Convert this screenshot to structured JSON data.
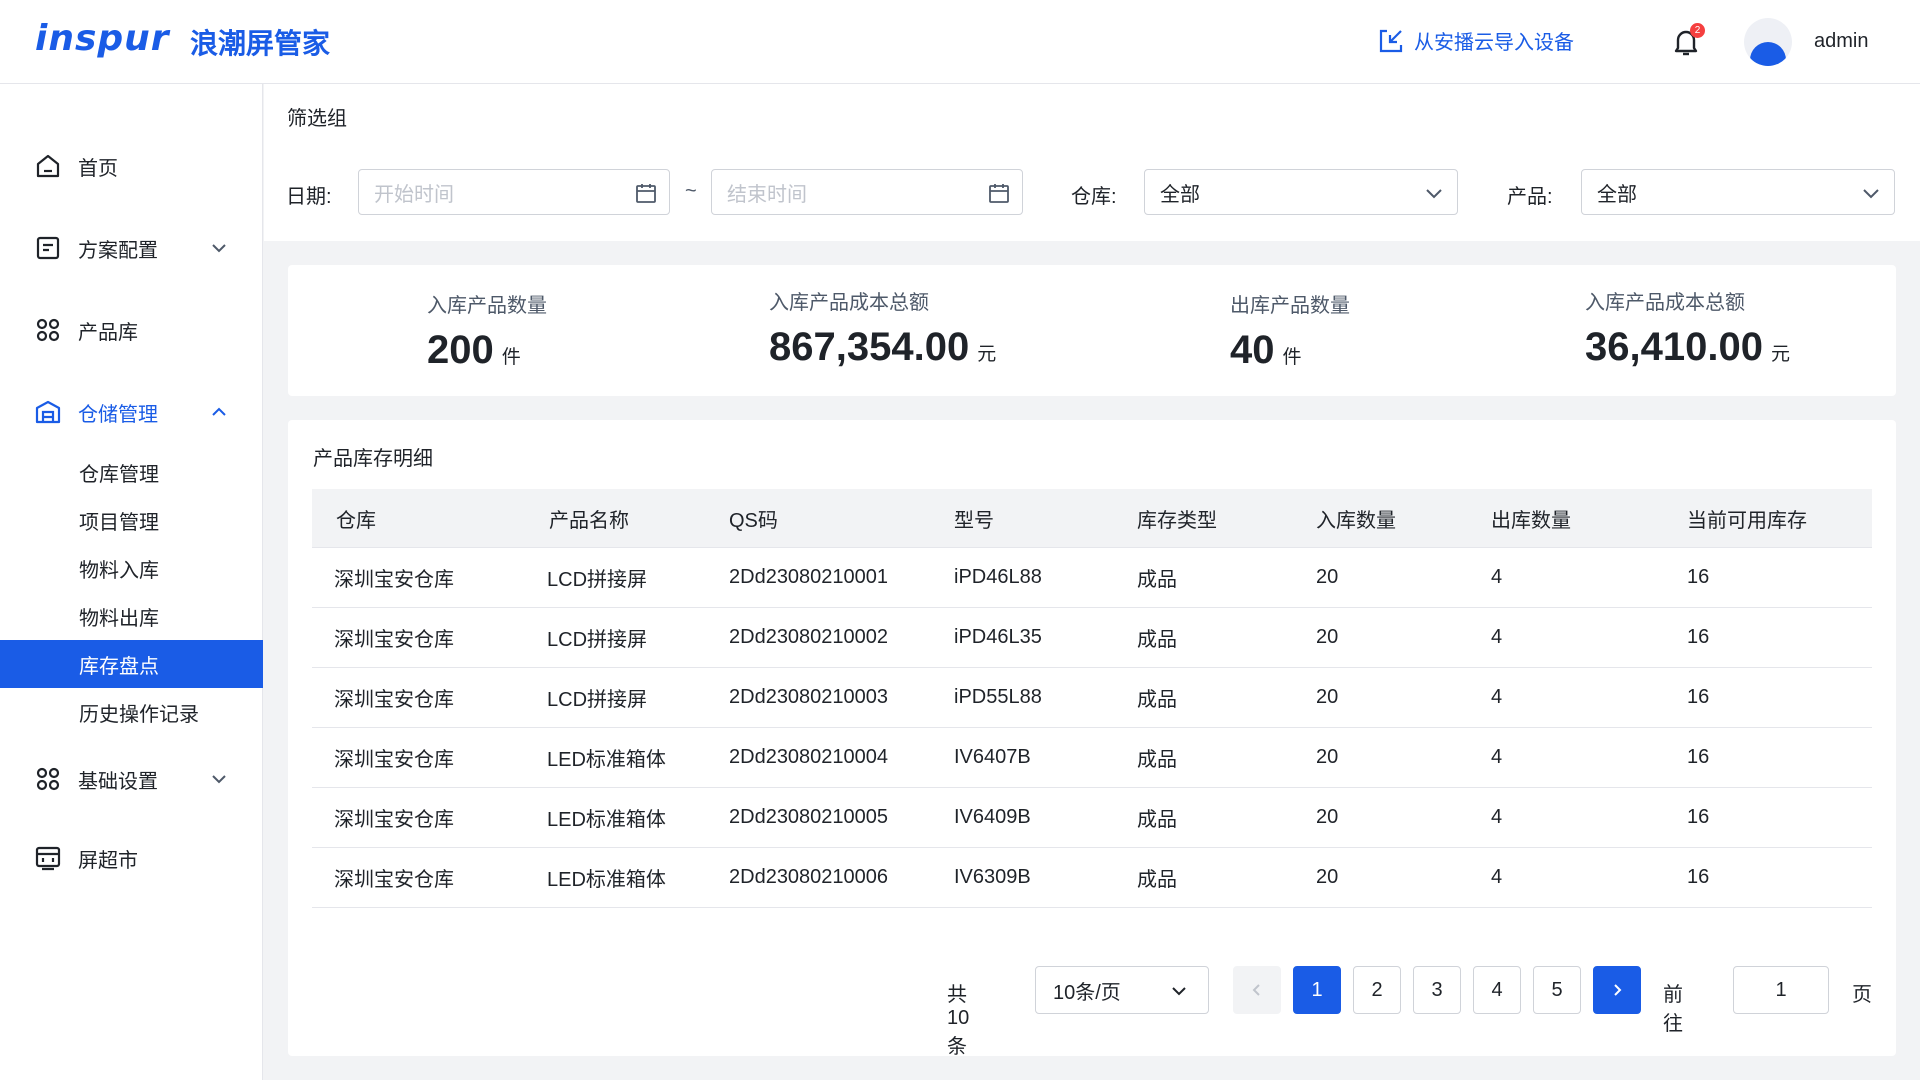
{
  "header": {
    "logo_text": "inspur",
    "brand": "浪潮屏管家",
    "import_label": "从安播云导入设备",
    "notification_count": "2",
    "username": "admin"
  },
  "sidebar": {
    "items": [
      {
        "label": "首页",
        "icon": "home-icon"
      },
      {
        "label": "方案配置",
        "icon": "document-icon"
      },
      {
        "label": "产品库",
        "icon": "grid-icon"
      },
      {
        "label": "仓储管理",
        "icon": "warehouse-icon"
      },
      {
        "label": "基础设置",
        "icon": "grid-icon"
      },
      {
        "label": "屏超市",
        "icon": "store-icon"
      }
    ],
    "sub_items": [
      "仓库管理",
      "项目管理",
      "物料入库",
      "物料出库",
      "库存盘点",
      "历史操作记录"
    ],
    "active_sub": "库存盘点"
  },
  "filter": {
    "title": "筛选组",
    "date_label": "日期:",
    "start_placeholder": "开始时间",
    "separator": "~",
    "end_placeholder": "结束时间",
    "warehouse_label": "仓库:",
    "warehouse_value": "全部",
    "product_label": "产品:",
    "product_value": "全部"
  },
  "stats": [
    {
      "label": "入库产品数量",
      "value": "200",
      "unit": "件"
    },
    {
      "label": "入库产品成本总额",
      "value": "867,354.00",
      "unit": "元"
    },
    {
      "label": "出库产品数量",
      "value": "40",
      "unit": "件"
    },
    {
      "label": "入库产品成本总额",
      "value": "36,410.00",
      "unit": "元"
    }
  ],
  "table": {
    "title": "产品库存明细",
    "columns": [
      "仓库",
      "产品名称",
      "QS码",
      "型号",
      "库存类型",
      "入库数量",
      "出库数量",
      "当前可用库存"
    ],
    "rows": [
      [
        "深圳宝安仓库",
        "LCD拼接屏",
        "2Dd23080210001",
        "iPD46L88",
        "成品",
        "20",
        "4",
        "16"
      ],
      [
        "深圳宝安仓库",
        "LCD拼接屏",
        "2Dd23080210002",
        "iPD46L35",
        "成品",
        "20",
        "4",
        "16"
      ],
      [
        "深圳宝安仓库",
        "LCD拼接屏",
        "2Dd23080210003",
        "iPD55L88",
        "成品",
        "20",
        "4",
        "16"
      ],
      [
        "深圳宝安仓库",
        "LED标准箱体",
        "2Dd23080210004",
        "IV6407B",
        "成品",
        "20",
        "4",
        "16"
      ],
      [
        "深圳宝安仓库",
        "LED标准箱体",
        "2Dd23080210005",
        "IV6409B",
        "成品",
        "20",
        "4",
        "16"
      ],
      [
        "深圳宝安仓库",
        "LED标准箱体",
        "2Dd23080210006",
        "IV6309B",
        "成品",
        "20",
        "4",
        "16"
      ]
    ]
  },
  "pagination": {
    "total": "共10条",
    "page_size": "10条/页",
    "pages": [
      "1",
      "2",
      "3",
      "4",
      "5"
    ],
    "current_page": "1",
    "goto_label": "前往",
    "goto_value": "1",
    "page_suffix": "页"
  },
  "colors": {
    "accent": "#1a5ce6",
    "badge": "#f53f3f",
    "background": "#f2f3f5"
  }
}
